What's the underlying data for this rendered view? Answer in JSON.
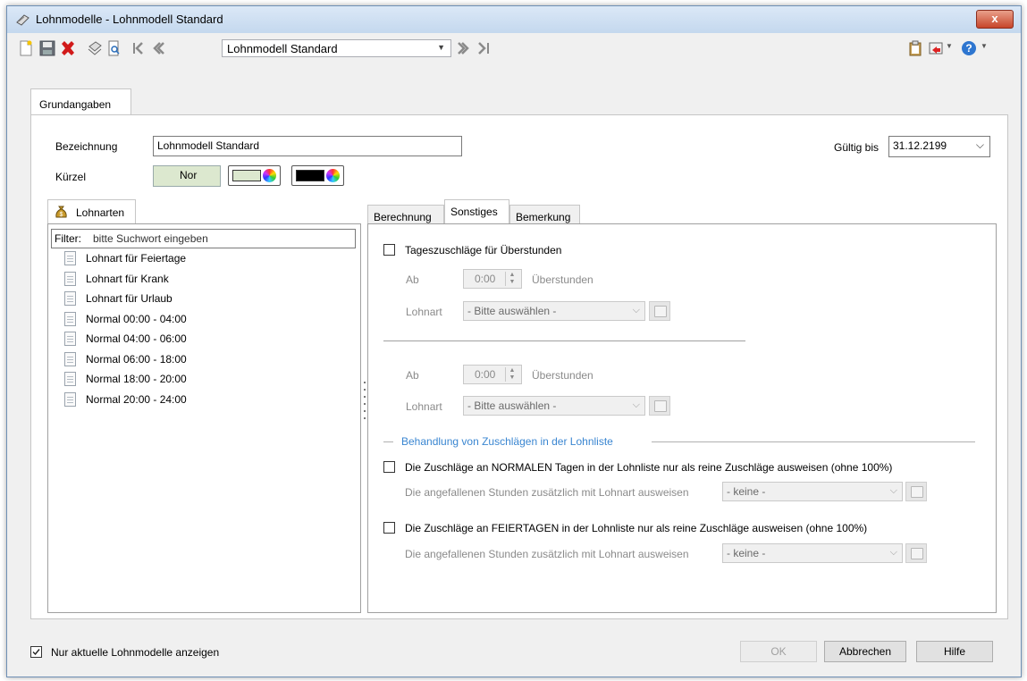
{
  "window": {
    "title": "Lohnmodelle - Lohnmodell Standard",
    "close_label": "x"
  },
  "toolbar": {
    "icons": [
      "new-document-icon",
      "save-icon",
      "delete-icon",
      "print-icon",
      "preview-icon",
      "first-record-icon",
      "previous-record-icon",
      "next-record-icon",
      "last-record-icon",
      "clipboard-icon",
      "import-icon",
      "help-icon"
    ],
    "record_combo": {
      "value": "Lohnmodell Standard"
    }
  },
  "main_tab": {
    "label": "Grundangaben"
  },
  "form": {
    "bezeichnung_label": "Bezeichnung",
    "bezeichnung_value": "Lohnmodell Standard",
    "kuerzel_label": "Kürzel",
    "kuerzel_value": "Nor",
    "kuerzel_bg_color": "#dce8cf",
    "text_color": "#000000",
    "gueltig_label": "Gültig bis",
    "gueltig_value": "31.12.2199"
  },
  "lohnarten": {
    "tab_label": "Lohnarten",
    "filter_label": "Filter:",
    "filter_placeholder": "bitte Suchwort eingeben",
    "items": [
      "Lohnart für Feiertage",
      "Lohnart für Krank",
      "Lohnart für Urlaub",
      "Normal 00:00 - 04:00",
      "Normal 04:00 - 06:00",
      "Normal 06:00 - 18:00",
      "Normal 18:00 - 20:00",
      "Normal 20:00 - 24:00"
    ]
  },
  "right_tabs": [
    "Berechnung",
    "Sonstiges",
    "Bemerkung"
  ],
  "sonstiges": {
    "tageszuschlaege_label": "Tageszuschläge für Überstunden",
    "block1": {
      "ab_label": "Ab",
      "ab_value": "0:00",
      "unit_label": "Überstunden",
      "lohnart_label": "Lohnart",
      "lohnart_value": "- Bitte auswählen -"
    },
    "block2": {
      "ab_label": "Ab",
      "ab_value": "0:00",
      "unit_label": "Überstunden",
      "lohnart_label": "Lohnart",
      "lohnart_value": "- Bitte auswählen -"
    },
    "section_title": "Behandlung von Zuschlägen in der Lohnliste",
    "normal_label": "Die Zuschläge an NORMALEN Tagen in der Lohnliste nur als reine Zuschläge ausweisen (ohne 100%)",
    "normal_sub_label": "Die angefallenen Stunden zusätzlich mit Lohnart ausweisen",
    "normal_sub_value": "- keine -",
    "feiertag_label": "Die Zuschläge an FEIERTAGEN in der Lohnliste nur als reine Zuschläge ausweisen (ohne 100%)",
    "feiertag_sub_label": "Die angefallenen Stunden zusätzlich mit Lohnart ausweisen",
    "feiertag_sub_value": "- keine -",
    "accent_color": "#3a86d1"
  },
  "footer": {
    "only_current_label": "Nur aktuelle Lohnmodelle anzeigen",
    "only_current_checked": true,
    "ok_label": "OK",
    "cancel_label": "Abbrechen",
    "help_label": "Hilfe"
  }
}
